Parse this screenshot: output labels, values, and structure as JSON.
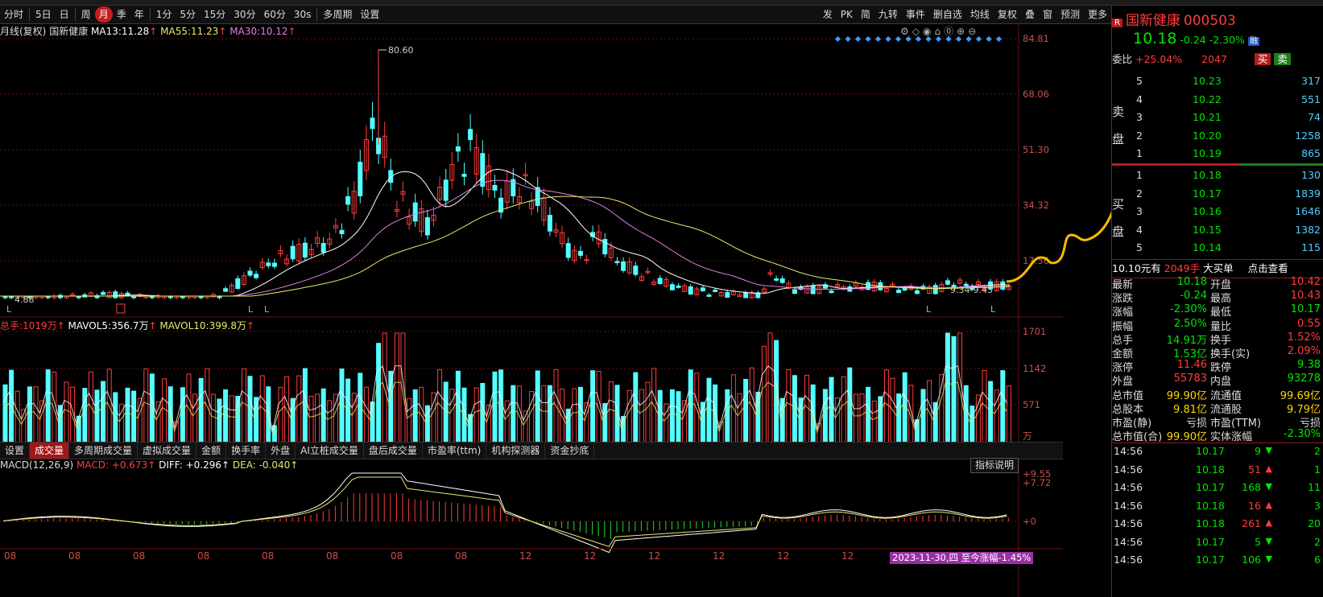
{
  "toolbar": {
    "items": [
      "分时",
      "5日",
      "日",
      "周",
      "月",
      "季",
      "年",
      "1分",
      "5分",
      "15分",
      "30分",
      "60分",
      "30s",
      "多周期",
      "设置"
    ],
    "selected_index": 4,
    "right_items": [
      "发",
      "PK",
      "简",
      "九转",
      "事件",
      "删自选",
      "均线",
      "复权",
      "叠",
      "窗",
      "预测",
      "更多"
    ]
  },
  "main_legend": {
    "prefix": "月线(复权)",
    "name": "国新健康",
    "ma13_label": "MA13:",
    "ma13": "11.28",
    "ma55_label": "MA55:",
    "ma55": "11.23",
    "ma30_label": "MA30:",
    "ma30": "10.12",
    "arrow": "↑"
  },
  "price_axis": [
    "84.81",
    "68.06",
    "51.30",
    "34.32",
    "17.56"
  ],
  "annotations": {
    "high": "80.60",
    "low": "4.88",
    "range": "9.34-9.43"
  },
  "vol_legend": {
    "prefix": "总手:",
    "value": "1019万",
    "mavol5_label": "MAVOL5:",
    "mavol5": "356.7万",
    "mavol10_label": "MAVOL10:",
    "mavol10": "399.8万",
    "arrow": "↑"
  },
  "vol_axis": [
    "1701",
    "1142",
    "571",
    "万"
  ],
  "indicator_tabs": [
    "设置",
    "成交量",
    "多周期成交量",
    "虚拟成交量",
    "金额",
    "换手率",
    "外盘",
    "AI立桩成交量",
    "盘后成交量",
    "市盈率(ttm)",
    "机构探测器",
    "资金抄底"
  ],
  "indicator_tab_selected": 1,
  "macd_legend": {
    "prefix": "MACD(12,26,9)",
    "macd": "MACD: +0.673↑",
    "diff": "DIFF: +0.296↑",
    "dea": "DEA: -0.040↑"
  },
  "macd_button": "指标说明",
  "macd_axis": [
    "+9.55",
    "+7.72",
    "+0"
  ],
  "xaxis": [
    "08",
    "08",
    "08",
    "08",
    "08",
    "08",
    "08",
    "08",
    "12",
    "12",
    "12",
    "12",
    "12",
    "12"
  ],
  "date_badge": "2023-11-30,四 至今涨幅-1.45%",
  "quote": {
    "code_prefix": "R",
    "name": "国新健康",
    "code": "000503",
    "price": "10.18",
    "change": "-0.24",
    "change_pct": "-2.30%",
    "market_tag": "融",
    "weibi_label": "委比",
    "weibi": "+25.04%",
    "weicha": "2047",
    "buy_btn": "买",
    "sell_btn": "卖",
    "sell_label": [
      "卖",
      "盘"
    ],
    "buy_label": [
      "买",
      "盘"
    ],
    "sells": [
      {
        "lvl": "5",
        "price": "10.23",
        "vol": "317"
      },
      {
        "lvl": "4",
        "price": "10.22",
        "vol": "551"
      },
      {
        "lvl": "3",
        "price": "10.21",
        "vol": "74"
      },
      {
        "lvl": "2",
        "price": "10.20",
        "vol": "1258"
      },
      {
        "lvl": "1",
        "price": "10.19",
        "vol": "865"
      }
    ],
    "buys": [
      {
        "lvl": "1",
        "price": "10.18",
        "vol": "130"
      },
      {
        "lvl": "2",
        "price": "10.17",
        "vol": "1839"
      },
      {
        "lvl": "3",
        "price": "10.16",
        "vol": "1646"
      },
      {
        "lvl": "4",
        "price": "10.15",
        "vol": "1382"
      },
      {
        "lvl": "5",
        "price": "10.14",
        "vol": "115"
      }
    ],
    "bigorder": {
      "price": "10.10元有",
      "vol": "2049手",
      "label": "大买单",
      "action": "点击查看"
    },
    "stats": [
      [
        "最新",
        "10.18",
        "开盘",
        "10.42"
      ],
      [
        "涨跌",
        "-0.24",
        "最高",
        "10.43"
      ],
      [
        "涨幅",
        "-2.30%",
        "最低",
        "10.17"
      ],
      [
        "振幅",
        "2.50%",
        "量比",
        "0.55"
      ],
      [
        "总手",
        "14.91万",
        "换手",
        "1.52%"
      ],
      [
        "金额",
        "1.53亿",
        "换手(实)",
        "2.09%"
      ],
      [
        "涨停",
        "11.46",
        "跌停",
        "9.38"
      ],
      [
        "外盘",
        "55783",
        "内盘",
        "93278"
      ],
      [
        "总市值",
        "99.90亿",
        "流通值",
        "99.69亿"
      ],
      [
        "总股本",
        "9.81亿",
        "流通股",
        "9.79亿"
      ],
      [
        "市盈(静)",
        "亏损",
        "市盈(TTM)",
        "亏损"
      ],
      [
        "总市值(合)",
        "99.90亿",
        "实体涨幅",
        "-2.30%"
      ]
    ],
    "ticks": [
      [
        "14:56",
        "10.17",
        "9",
        "2"
      ],
      [
        "14:56",
        "10.18",
        "51",
        "1"
      ],
      [
        "14:56",
        "10.17",
        "168",
        "11"
      ],
      [
        "14:56",
        "10.18",
        "16",
        "3"
      ],
      [
        "14:56",
        "10.18",
        "261",
        "20"
      ],
      [
        "14:56",
        "10.17",
        "5",
        "2"
      ],
      [
        "14:56",
        "10.17",
        "106",
        "6"
      ]
    ],
    "tick_dirs": [
      "down",
      "up",
      "down",
      "up",
      "up",
      "down",
      "down"
    ]
  },
  "colors": {
    "up": "#ff3c3c",
    "down": "#54ffff",
    "ma13": "#ffffff",
    "ma55": "#e8e86a",
    "ma30": "#e080e0",
    "grid": "#6a1010"
  }
}
